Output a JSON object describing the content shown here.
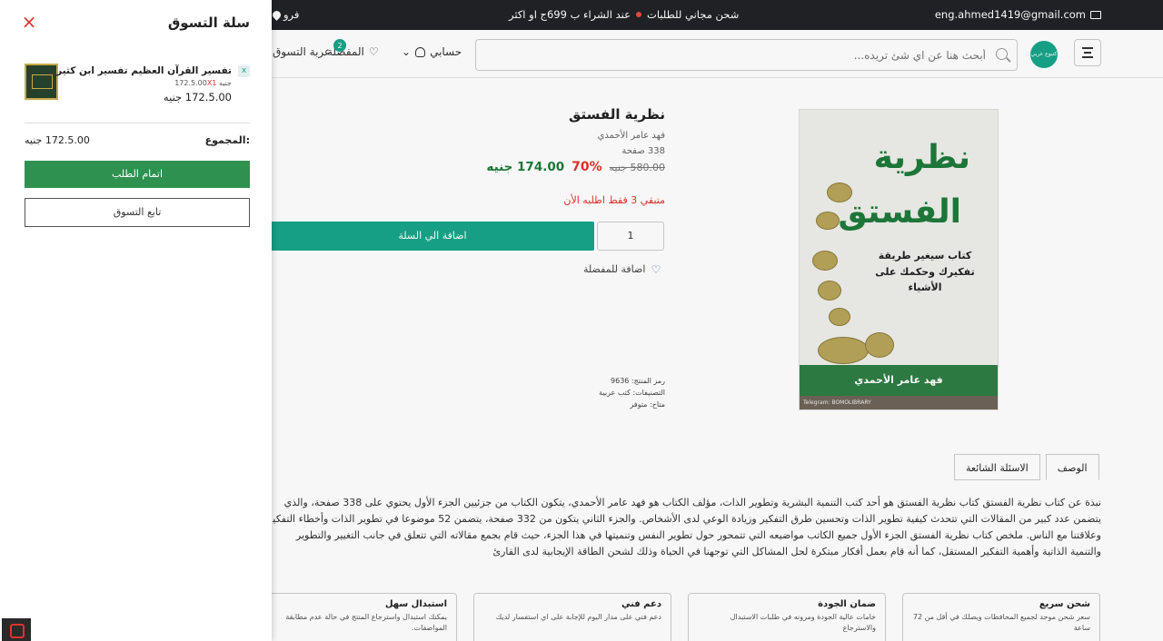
{
  "topbar": {
    "email": "eng.ahmed1419@gmail.com",
    "promo_free": "شحن مجاني للطلبات",
    "promo_condition": "عند الشراء ب 699ج او اكثر",
    "branch": "فرو"
  },
  "header": {
    "logo_text": "كتبوع عربي",
    "search_placeholder": "أبحث هنا عن اي شئ تريده...",
    "account_label": "حسابي",
    "favorites_label": "المفضلة",
    "favorites_count": "2",
    "cart_label": "عربة التسوق"
  },
  "product": {
    "cover": {
      "title_line1": "نظرية",
      "title_line2": "الفستق",
      "subtitle": "كتاب سيغير طريقة تفكيرك وحكمك على الأشياء",
      "author_band": "فهد عامر الأحمدي",
      "footer": "Telegram: BOMOLIBRARY"
    },
    "title": "نظرية الفستق",
    "author": "فهد عامر الأحمدي",
    "pages": "338 صفحة",
    "price_new": "174.00 جنيه",
    "discount": "70%",
    "price_old": "580.00 جنيه",
    "stock": "متبقي 3 فقط اطلبه الأن",
    "quantity": "1",
    "add_to_cart": "اضافة الي السلة",
    "add_to_favorites": "اضافة للمفضلة",
    "meta": {
      "sku": "رمز المنتج: 9636",
      "categories": "التصنيفات: كتب عربية",
      "availability": "متاح: متوفر"
    }
  },
  "tabs": [
    {
      "label": "الوصف"
    },
    {
      "label": "الاسئلة الشائعة"
    }
  ],
  "description": [
    "نبذة عن كتاب نظرية الفستق كتاب نظرية الفستق هو أحد كتب التنمية البشرية وتطوير الذات، مؤلف الكتاب هو فهد عامر الأحمدي، يتكون الكتاب من جزئيين الجزء الأول يحتوي على 338 صفحة، والذي",
    "يتضمن عدد كبير من المقالات التي تتحدث كيفية تطوير الذات وتحسين طرق التفكير وزيادة الوعي لدى الأشخاص. والجزء الثاني يتكون من 332 صفحة، يتضمن 52 موضوعا في تطوير الذات وأخطاء التفكير",
    "وعلاقتنا مع الناس. ملخص كتاب نظرية الفستق الجزء الأول جميع الكاتب مواضيعه التي تتمحور حول تطوير النفس وتنميتها في هذا الجزء، حيث قام بجمع مقالاته التي تتعلق في جانب التغيير والتطوير",
    "والتنمية الذاتية وأهمية التفكير المستقل، كما أنه قام بعمل أفكار مبتكرة لحل المشاكل التي توجهنا في الحياة وذلك لشحن الطاقة الإيجابية لدى القارئ"
  ],
  "features": [
    {
      "title": "شحن سريع",
      "text": "سعر شحن موحد لجميع المحافظات ويصلك في أقل من 72 ساعة"
    },
    {
      "title": "ضمان الجودة",
      "text": "خامات عالية الجودة ومرونه في طلبات الاستبدال والاسترجاع"
    },
    {
      "title": "دعم فني",
      "text": "دعم فني على مدار اليوم للإجابة على اي استفسار لديك"
    },
    {
      "title": "استبدال سهل",
      "text": "يمكنك استبدال واسترجاع المنتج في حالة عدم مطابقة المواصفات."
    }
  ],
  "cart_drawer": {
    "title": "سلة التسوق",
    "close_icon": "×",
    "item": {
      "name": "تفسير القرآن العظيم تفسير ابن كثير",
      "remove": "x",
      "qty_prefix": "172.5.00",
      "qty_suffix": "جنيه",
      "qty_mult": "X1",
      "total": "172.5.00 جنيه"
    },
    "sum_label": "المجموع:",
    "sum_value": "172.5.00 جنيه",
    "checkout": "اتمام الطلب",
    "continue": "تابع التسوق"
  }
}
